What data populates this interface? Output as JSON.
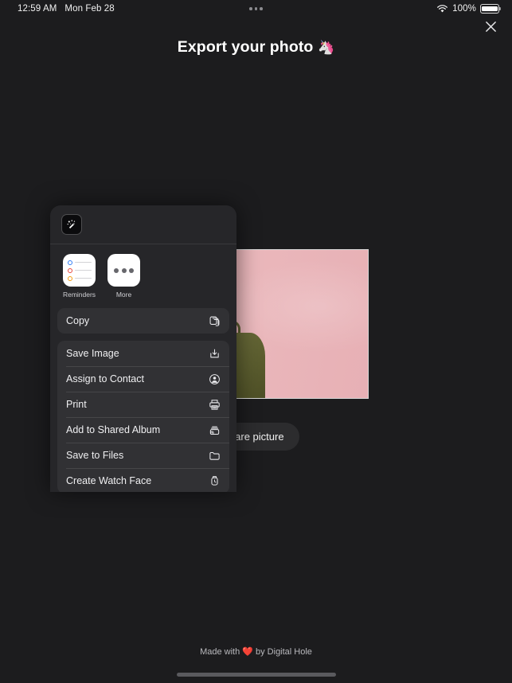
{
  "status_bar": {
    "time": "12:59 AM",
    "date": "Mon Feb 28",
    "battery_percent": "100%",
    "wifi_icon": "wifi-icon",
    "battery_icon": "battery-full-icon",
    "recording_dots_icon": "three-dots-indicator-icon"
  },
  "header": {
    "title": "Export your photo",
    "title_emoji": "🦄",
    "close_icon": "close-icon"
  },
  "photo": {
    "alt": "person in denim jacket with olive backpack against pink wall"
  },
  "actions": {
    "occluded_button_label": "e",
    "share_button_label": "Share picture",
    "share_icon": "share-up-arrow-icon"
  },
  "footer": {
    "text_prefix": "Made with",
    "heart_emoji": "❤️",
    "text_suffix": "by Digital Hole",
    "full_text": "Made with ❤️ by Digital Hole"
  },
  "share_sheet": {
    "app_icon": "magic-wand-icon",
    "targets": [
      {
        "label": "Reminders",
        "icon": "reminders-app-icon"
      },
      {
        "label": "More",
        "icon": "more-dots-icon"
      }
    ],
    "groups": [
      {
        "rows": [
          {
            "label": "Copy",
            "icon": "copy-icon"
          }
        ]
      },
      {
        "rows": [
          {
            "label": "Save Image",
            "icon": "save-download-icon"
          },
          {
            "label": "Assign to Contact",
            "icon": "person-circle-icon"
          },
          {
            "label": "Print",
            "icon": "printer-icon"
          },
          {
            "label": "Add to Shared Album",
            "icon": "shared-album-icon"
          },
          {
            "label": "Save to Files",
            "icon": "folder-icon"
          },
          {
            "label": "Create Watch Face",
            "icon": "watch-face-icon"
          }
        ]
      }
    ]
  },
  "colors": {
    "background": "#1c1c1e",
    "sheet": "#262629",
    "row": "#313134",
    "pill": "#2c2c2e",
    "text": "#f0f0f2",
    "photo_pink": "#e8b4b8"
  }
}
